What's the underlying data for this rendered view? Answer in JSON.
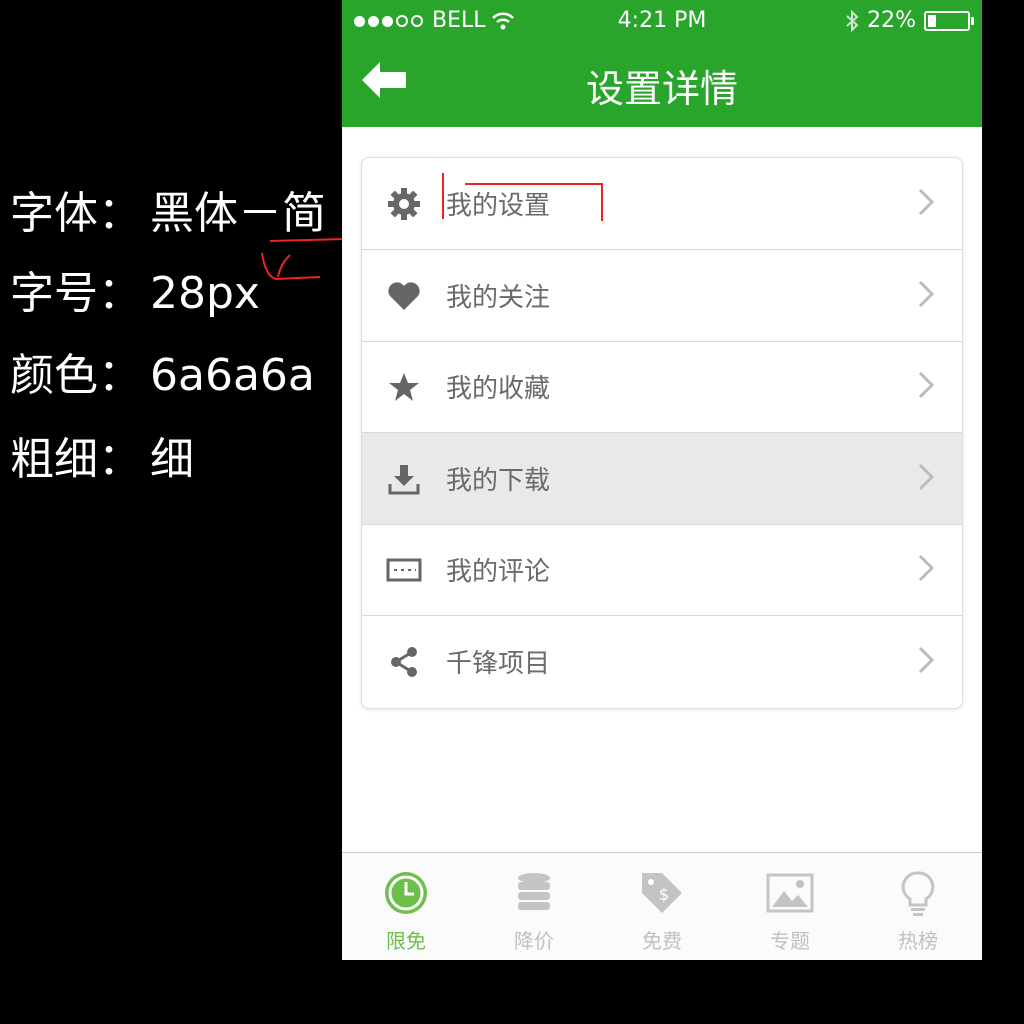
{
  "annotations": [
    {
      "key": "字体：",
      "value": "黑体－简"
    },
    {
      "key": "字号：",
      "value": "28px"
    },
    {
      "key": "颜色：",
      "value": "6a6a6a"
    },
    {
      "key": "粗细：",
      "value": "细"
    }
  ],
  "status_bar": {
    "carrier": "BELL",
    "time": "4:21 PM",
    "battery": "22%"
  },
  "nav": {
    "title": "设置详情"
  },
  "menu": [
    {
      "label": "我的设置",
      "icon": "gear-icon"
    },
    {
      "label": "我的关注",
      "icon": "heart-icon"
    },
    {
      "label": "我的收藏",
      "icon": "star-icon"
    },
    {
      "label": "我的下载",
      "icon": "download-icon"
    },
    {
      "label": "我的评论",
      "icon": "comment-icon"
    },
    {
      "label": "千锋项目",
      "icon": "share-icon"
    }
  ],
  "tabs": [
    {
      "label": "限免",
      "icon": "clock-icon",
      "active": true
    },
    {
      "label": "降价",
      "icon": "coins-icon"
    },
    {
      "label": "免费",
      "icon": "price-tag-icon"
    },
    {
      "label": "专题",
      "icon": "image-icon"
    },
    {
      "label": "热榜",
      "icon": "lightbulb-icon"
    }
  ],
  "colors": {
    "brand_green": "#2aa52c",
    "label_gray": "#6a6a6a",
    "active_tab": "#6cc04a"
  }
}
